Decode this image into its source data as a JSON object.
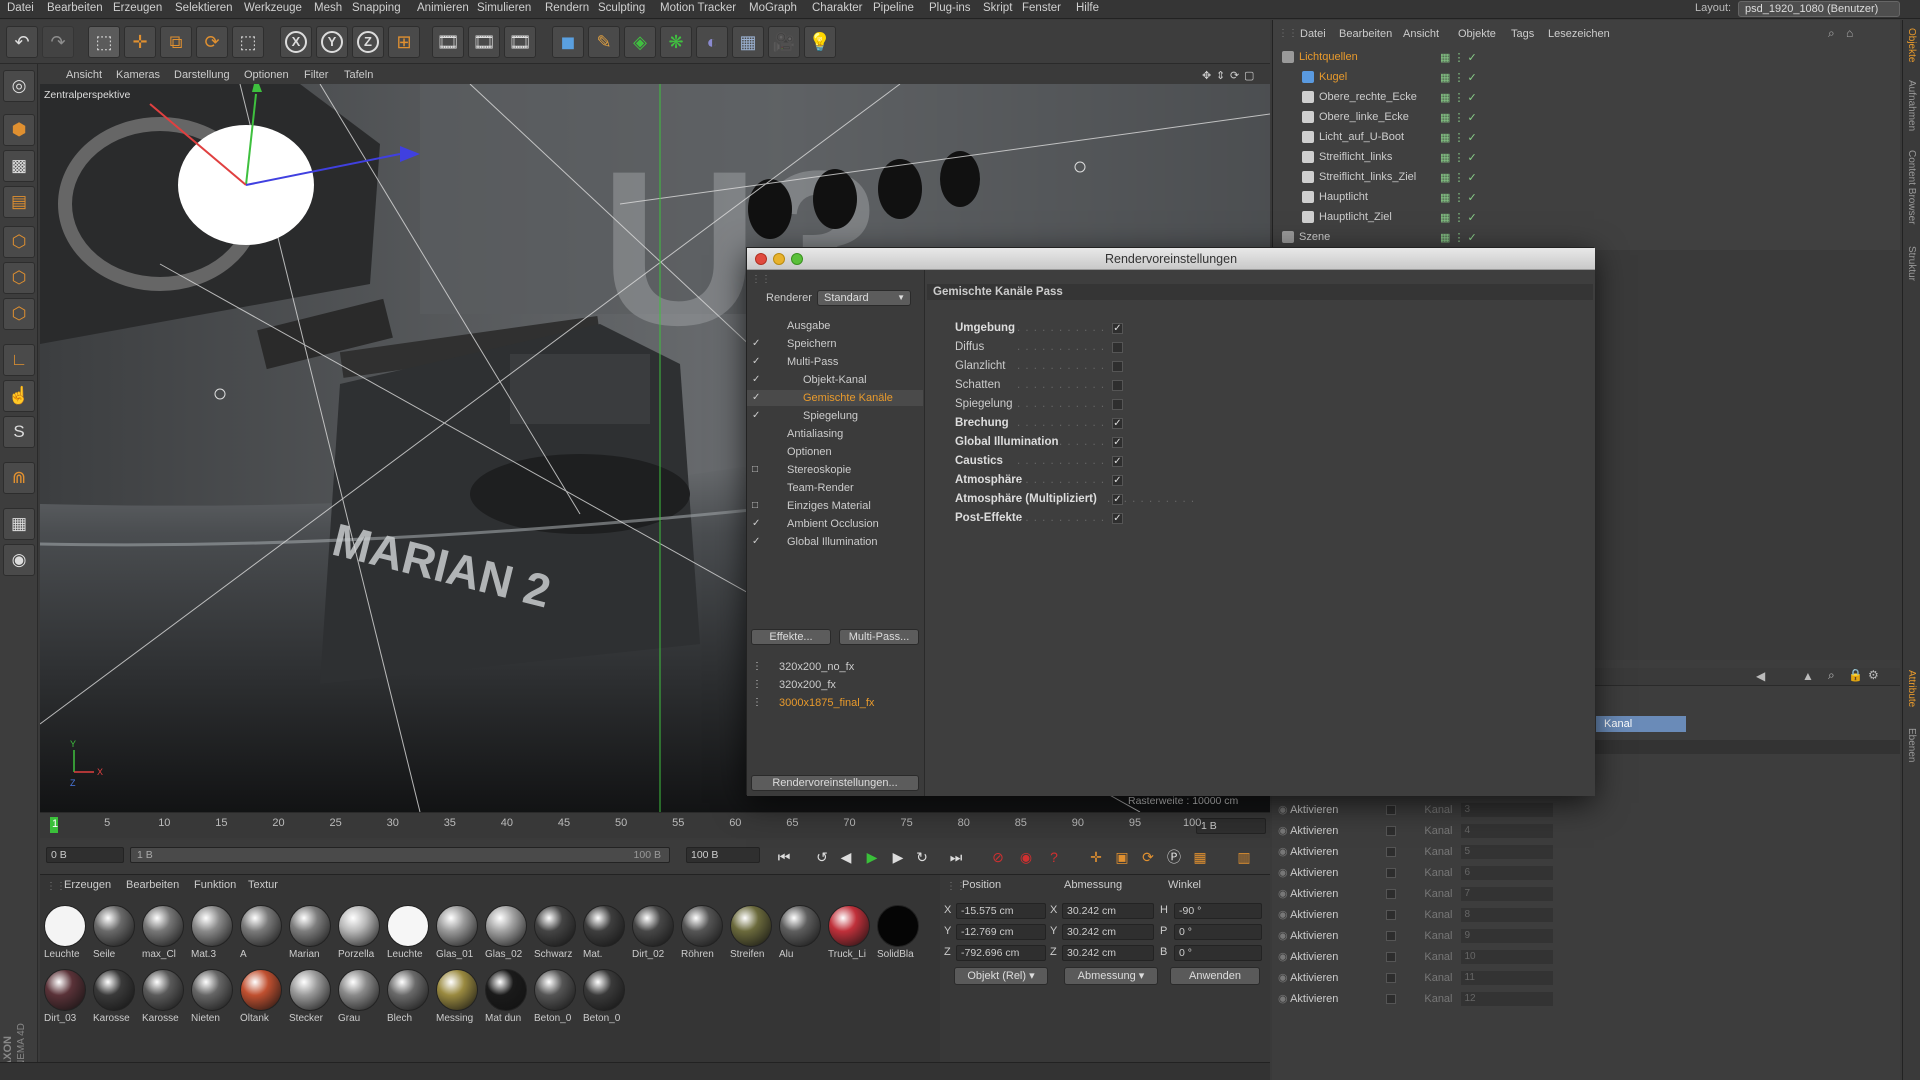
{
  "menubar": {
    "items": [
      "Datei",
      "Bearbeiten",
      "Erzeugen",
      "Selektieren",
      "Werkzeuge",
      "Mesh",
      "Snapping",
      "Animieren",
      "Simulieren",
      "Rendern",
      "Sculpting",
      "Motion Tracker",
      "MoGraph",
      "Charakter",
      "Pipeline",
      "Plug-ins",
      "Skript",
      "Fenster",
      "Hilfe"
    ],
    "layout_label": "Layout:",
    "layout_value": "psd_1920_1080 (Benutzer)"
  },
  "viewport": {
    "menu": [
      "Ansicht",
      "Kameras",
      "Darstellung",
      "Optionen",
      "Filter",
      "Tafeln"
    ],
    "label": "Zentralperspektive",
    "raster": "Rasterweite : 10000 cm",
    "hull_text": "MARIAN 2"
  },
  "timeline": {
    "ticks": [
      "0",
      "5",
      "10",
      "15",
      "20",
      "25",
      "30",
      "35",
      "40",
      "45",
      "50",
      "55",
      "60",
      "65",
      "70",
      "75",
      "80",
      "85",
      "90",
      "95",
      "100"
    ],
    "current_frame": "1",
    "frame_field": "1 B",
    "start_field": "0 B",
    "range_start": "1 B",
    "range_end": "100 B",
    "end_field": "100 B"
  },
  "material_manager": {
    "menu": [
      "Erzeugen",
      "Bearbeiten",
      "Funktion",
      "Textur"
    ],
    "materials": [
      {
        "name": "Leuchte",
        "color": "#f4f4f4"
      },
      {
        "name": "Seile",
        "color": "#6a6a6a"
      },
      {
        "name": "max_Cl",
        "color": "#777777"
      },
      {
        "name": "Mat.3",
        "color": "#8a8a8a"
      },
      {
        "name": "A",
        "color": "#7a7a7a"
      },
      {
        "name": "Marian",
        "color": "#7d7d7d"
      },
      {
        "name": "Porzella",
        "color": "#b8b8b8"
      },
      {
        "name": "Leuchte",
        "color": "#f6f6f6"
      },
      {
        "name": "Glas_01",
        "color": "#9a9a9a"
      },
      {
        "name": "Glas_02",
        "color": "#a2a2a2"
      },
      {
        "name": "Schwarz",
        "color": "#444444"
      },
      {
        "name": "Mat.",
        "color": "#3e3e3e"
      },
      {
        "name": "Dirt_02",
        "color": "#474747"
      },
      {
        "name": "Röhren",
        "color": "#555555"
      },
      {
        "name": "Streifen",
        "color": "#6b6a3c"
      },
      {
        "name": "Alu",
        "color": "#5e5e5e"
      },
      {
        "name": "Truck_Li",
        "color": "#c0303a"
      },
      {
        "name": "SolidBla",
        "color": "#050505"
      },
      {
        "name": "Dirt_03",
        "color": "#5a3238"
      },
      {
        "name": "Karosse",
        "color": "#3a3a3a"
      },
      {
        "name": "Karosse",
        "color": "#5a5a5a"
      },
      {
        "name": "Nieten",
        "color": "#666666"
      },
      {
        "name": "Öltank",
        "color": "#c05030"
      },
      {
        "name": "Stecker",
        "color": "#9a9a9a"
      },
      {
        "name": "Grau",
        "color": "#8a8a8a"
      },
      {
        "name": "Blech",
        "color": "#6a6a6a"
      },
      {
        "name": "Messing",
        "color": "#9a8a40"
      },
      {
        "name": "Mat dun",
        "color": "#1a1a1a"
      },
      {
        "name": "Beton_0",
        "color": "#555555"
      },
      {
        "name": "Beton_0",
        "color": "#3a3a3a"
      }
    ]
  },
  "coord_manager": {
    "headers": [
      "Position",
      "Abmessung",
      "Winkel"
    ],
    "rows": [
      {
        "axis": "X",
        "pos": "-15.575 cm",
        "size_axis": "X",
        "size": "30.242 cm",
        "ang_axis": "H",
        "ang": "-90 °"
      },
      {
        "axis": "Y",
        "pos": "-12.769 cm",
        "size_axis": "Y",
        "size": "30.242 cm",
        "ang_axis": "P",
        "ang": "0 °"
      },
      {
        "axis": "Z",
        "pos": "-792.696 cm",
        "size_axis": "Z",
        "size": "30.242 cm",
        "ang_axis": "B",
        "ang": "0 °"
      }
    ],
    "mode_select": "Objekt (Rel)",
    "size_select": "Abmessung",
    "apply": "Anwenden"
  },
  "object_manager": {
    "menu": [
      "Datei",
      "Bearbeiten",
      "Ansicht",
      "Objekte",
      "Tags",
      "Lesezeichen"
    ],
    "objects": [
      {
        "name": "Lichtquellen",
        "level": 0,
        "accent": true
      },
      {
        "name": "Kugel",
        "level": 1,
        "accent": true
      },
      {
        "name": "Obere_rechte_Ecke",
        "level": 1,
        "accent": false
      },
      {
        "name": "Obere_linke_Ecke",
        "level": 1,
        "accent": false
      },
      {
        "name": "Licht_auf_U-Boot",
        "level": 1,
        "accent": false
      },
      {
        "name": "Streiflicht_links",
        "level": 1,
        "accent": false
      },
      {
        "name": "Streiflicht_links_Ziel",
        "level": 1,
        "accent": false
      },
      {
        "name": "Hauptlicht",
        "level": 1,
        "accent": false
      },
      {
        "name": "Hauptlicht_Ziel",
        "level": 1,
        "accent": false
      },
      {
        "name": "Szene",
        "level": 0,
        "accent": false
      }
    ]
  },
  "side_tabs": [
    "Objekte",
    "Aufnahmen",
    "Content Browser",
    "Struktur",
    "Attribute",
    "Ebenen"
  ],
  "attribute_manager": {
    "kanal_tab": "Kanal",
    "rows": [
      {
        "label": "Aktivieren",
        "kanal": "Kanal",
        "value": "3"
      },
      {
        "label": "Aktivieren",
        "kanal": "Kanal",
        "value": "4"
      },
      {
        "label": "Aktivieren",
        "kanal": "Kanal",
        "value": "5"
      },
      {
        "label": "Aktivieren",
        "kanal": "Kanal",
        "value": "6"
      },
      {
        "label": "Aktivieren",
        "kanal": "Kanal",
        "value": "7"
      },
      {
        "label": "Aktivieren",
        "kanal": "Kanal",
        "value": "8"
      },
      {
        "label": "Aktivieren",
        "kanal": "Kanal",
        "value": "9"
      },
      {
        "label": "Aktivieren",
        "kanal": "Kanal",
        "value": "10"
      },
      {
        "label": "Aktivieren",
        "kanal": "Kanal",
        "value": "11"
      },
      {
        "label": "Aktivieren",
        "kanal": "Kanal",
        "value": "12"
      }
    ]
  },
  "dialog": {
    "title": "Rendervoreinstellungen",
    "renderer_label": "Renderer",
    "renderer_value": "Standard",
    "section_title": "Gemischte Kanäle Pass",
    "tree": [
      {
        "label": "Ausgabe",
        "check": "",
        "indent": 1,
        "active": false
      },
      {
        "label": "Speichern",
        "check": "✓",
        "indent": 1,
        "active": false
      },
      {
        "label": "Multi-Pass",
        "check": "✓",
        "indent": 1,
        "active": false
      },
      {
        "label": "Objekt-Kanal",
        "check": "✓",
        "indent": 2,
        "active": false
      },
      {
        "label": "Gemischte Kanäle",
        "check": "✓",
        "indent": 2,
        "active": true
      },
      {
        "label": "Spiegelung",
        "check": "✓",
        "indent": 2,
        "active": false
      },
      {
        "label": "Antialiasing",
        "check": "",
        "indent": 1,
        "active": false
      },
      {
        "label": "Optionen",
        "check": "",
        "indent": 1,
        "active": false
      },
      {
        "label": "Stereoskopie",
        "check": "□",
        "indent": 1,
        "active": false
      },
      {
        "label": "Team-Render",
        "check": "",
        "indent": 1,
        "active": false
      },
      {
        "label": "Einziges Material",
        "check": "□",
        "indent": 1,
        "active": false
      },
      {
        "label": "Ambient Occlusion",
        "check": "✓",
        "indent": 1,
        "active": false
      },
      {
        "label": "Global Illumination",
        "check": "✓",
        "indent": 1,
        "active": false
      }
    ],
    "btn_effekte": "Effekte...",
    "btn_multipass": "Multi-Pass...",
    "presets": [
      {
        "label": "320x200_no_fx",
        "active": false
      },
      {
        "label": "320x200_fx",
        "active": false
      },
      {
        "label": "3000x1875_final_fx",
        "active": true
      }
    ],
    "btn_bottom": "Rendervoreinstellungen...",
    "props": [
      {
        "label": "Umgebung",
        "checked": true,
        "bold": true
      },
      {
        "label": "Diffus",
        "checked": false,
        "bold": false
      },
      {
        "label": "Glanzlicht",
        "checked": false,
        "bold": false
      },
      {
        "label": "Schatten",
        "checked": false,
        "bold": false
      },
      {
        "label": "Spiegelung",
        "checked": false,
        "bold": false
      },
      {
        "label": "Brechung",
        "checked": true,
        "bold": true
      },
      {
        "label": "Global Illumination",
        "checked": true,
        "bold": true
      },
      {
        "label": "Caustics",
        "checked": true,
        "bold": true
      },
      {
        "label": "Atmosphäre",
        "checked": true,
        "bold": true
      },
      {
        "label": "Atmosphäre (Multipliziert)",
        "checked": true,
        "bold": true
      },
      {
        "label": "Post-Effekte",
        "checked": true,
        "bold": true
      }
    ]
  },
  "colors": {
    "accent": "#e89a2c",
    "selection": "#6a8bb8",
    "play_green": "#3ac03a",
    "record_red": "#d03030"
  }
}
